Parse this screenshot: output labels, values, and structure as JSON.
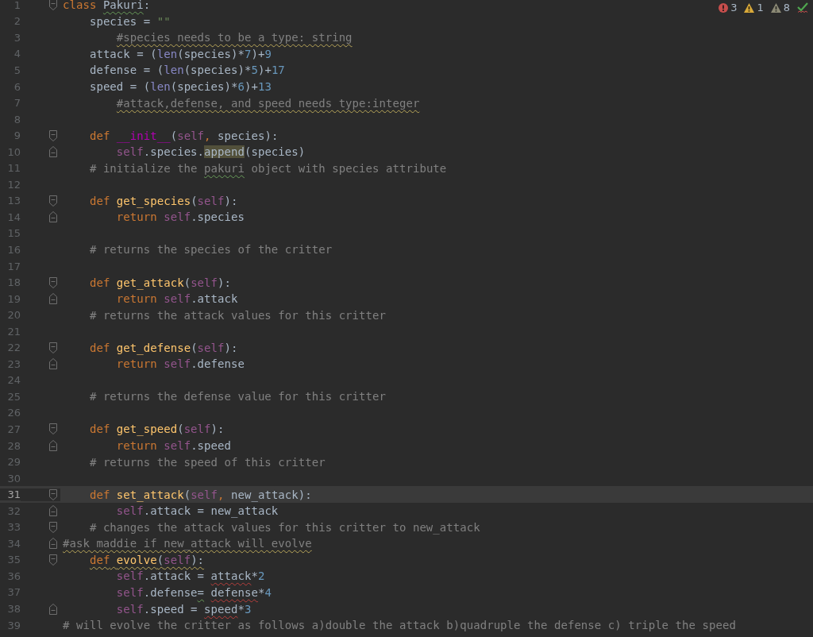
{
  "inspections": {
    "errors": "3",
    "warnings": "1",
    "weak_warnings": "8"
  },
  "lines": [
    {
      "number": "1",
      "current": false,
      "fold": {
        "kind": "start"
      },
      "tokens": [
        {
          "text": "class ",
          "kind": "keyword"
        },
        {
          "text": "Pakuri",
          "kind": "plain",
          "squiggle": {
            "kind": "typo"
          }
        },
        {
          "text": ":",
          "kind": "plain"
        }
      ]
    },
    {
      "number": "2",
      "current": false,
      "tokens": [
        {
          "text": "    species = ",
          "kind": "plain"
        },
        {
          "text": "\"\"",
          "kind": "string"
        }
      ]
    },
    {
      "number": "3",
      "current": false,
      "tokens": [
        {
          "text": "        #species needs to be a type: string",
          "kind": "comment",
          "squiggle": {
            "kind": "warning"
          }
        }
      ]
    },
    {
      "number": "4",
      "current": false,
      "tokens": [
        {
          "text": "    attack = (",
          "kind": "plain"
        },
        {
          "text": "len",
          "kind": "builtin"
        },
        {
          "text": "(species)*",
          "kind": "plain"
        },
        {
          "text": "7",
          "kind": "number"
        },
        {
          "text": ")+",
          "kind": "plain"
        },
        {
          "text": "9",
          "kind": "number"
        }
      ]
    },
    {
      "number": "5",
      "current": false,
      "tokens": [
        {
          "text": "    defense = (",
          "kind": "plain"
        },
        {
          "text": "len",
          "kind": "builtin"
        },
        {
          "text": "(species)*",
          "kind": "plain"
        },
        {
          "text": "5",
          "kind": "number"
        },
        {
          "text": ")+",
          "kind": "plain"
        },
        {
          "text": "17",
          "kind": "number"
        }
      ]
    },
    {
      "number": "6",
      "current": false,
      "tokens": [
        {
          "text": "    speed = (",
          "kind": "plain"
        },
        {
          "text": "len",
          "kind": "builtin"
        },
        {
          "text": "(species)*",
          "kind": "plain"
        },
        {
          "text": "6",
          "kind": "number"
        },
        {
          "text": ")+",
          "kind": "plain"
        },
        {
          "text": "13",
          "kind": "number"
        }
      ]
    },
    {
      "number": "7",
      "current": false,
      "tokens": [
        {
          "text": "        #attack,defense, and speed needs type:integer",
          "kind": "comment",
          "squiggle": {
            "kind": "warning"
          }
        }
      ]
    },
    {
      "number": "8",
      "current": false
    },
    {
      "number": "9",
      "current": false,
      "fold": {
        "kind": "start"
      },
      "tokens": [
        {
          "text": "    def ",
          "kind": "keyword"
        },
        {
          "text": "__init__",
          "kind": "magic"
        },
        {
          "text": "(",
          "kind": "plain"
        },
        {
          "text": "self",
          "kind": "self"
        },
        {
          "text": ", ",
          "kind": "keyword"
        },
        {
          "text": "species):",
          "kind": "plain"
        }
      ]
    },
    {
      "number": "10",
      "current": false,
      "fold": {
        "kind": "end"
      },
      "tokens": [
        {
          "text": "        self",
          "kind": "self"
        },
        {
          "text": ".species.",
          "kind": "plain"
        },
        {
          "text": "append",
          "kind": "plain",
          "highlight": true
        },
        {
          "text": "(species)",
          "kind": "plain"
        }
      ]
    },
    {
      "number": "11",
      "current": false,
      "tokens": [
        {
          "text": "    # initialize the ",
          "kind": "comment"
        },
        {
          "text": "pakuri",
          "kind": "comment",
          "squiggle": {
            "kind": "typo"
          }
        },
        {
          "text": " object with species attribute",
          "kind": "comment"
        }
      ]
    },
    {
      "number": "12",
      "current": false
    },
    {
      "number": "13",
      "current": false,
      "fold": {
        "kind": "start"
      },
      "tokens": [
        {
          "text": "    def ",
          "kind": "keyword"
        },
        {
          "text": "get_species",
          "kind": "function"
        },
        {
          "text": "(",
          "kind": "plain"
        },
        {
          "text": "self",
          "kind": "self"
        },
        {
          "text": "):",
          "kind": "plain"
        }
      ]
    },
    {
      "number": "14",
      "current": false,
      "fold": {
        "kind": "end"
      },
      "tokens": [
        {
          "text": "        return ",
          "kind": "keyword"
        },
        {
          "text": "self",
          "kind": "self"
        },
        {
          "text": ".species",
          "kind": "plain"
        }
      ]
    },
    {
      "number": "15",
      "current": false
    },
    {
      "number": "16",
      "current": false,
      "tokens": [
        {
          "text": "    # returns the species of the critter",
          "kind": "comment"
        }
      ]
    },
    {
      "number": "17",
      "current": false
    },
    {
      "number": "18",
      "current": false,
      "fold": {
        "kind": "start"
      },
      "tokens": [
        {
          "text": "    def ",
          "kind": "keyword"
        },
        {
          "text": "get_attack",
          "kind": "function"
        },
        {
          "text": "(",
          "kind": "plain"
        },
        {
          "text": "self",
          "kind": "self"
        },
        {
          "text": "):",
          "kind": "plain"
        }
      ]
    },
    {
      "number": "19",
      "current": false,
      "fold": {
        "kind": "end"
      },
      "tokens": [
        {
          "text": "        return ",
          "kind": "keyword"
        },
        {
          "text": "self",
          "kind": "self"
        },
        {
          "text": ".attack",
          "kind": "plain"
        }
      ]
    },
    {
      "number": "20",
      "current": false,
      "tokens": [
        {
          "text": "    # returns the attack values for this critter",
          "kind": "comment"
        }
      ]
    },
    {
      "number": "21",
      "current": false
    },
    {
      "number": "22",
      "current": false,
      "fold": {
        "kind": "start"
      },
      "tokens": [
        {
          "text": "    def ",
          "kind": "keyword"
        },
        {
          "text": "get_defense",
          "kind": "function"
        },
        {
          "text": "(",
          "kind": "plain"
        },
        {
          "text": "self",
          "kind": "self"
        },
        {
          "text": "):",
          "kind": "plain"
        }
      ]
    },
    {
      "number": "23",
      "current": false,
      "fold": {
        "kind": "end"
      },
      "tokens": [
        {
          "text": "        return ",
          "kind": "keyword"
        },
        {
          "text": "self",
          "kind": "self"
        },
        {
          "text": ".defense",
          "kind": "plain"
        }
      ]
    },
    {
      "number": "24",
      "current": false
    },
    {
      "number": "25",
      "current": false,
      "tokens": [
        {
          "text": "    # returns the defense value for this critter",
          "kind": "comment"
        }
      ]
    },
    {
      "number": "26",
      "current": false
    },
    {
      "number": "27",
      "current": false,
      "fold": {
        "kind": "start"
      },
      "tokens": [
        {
          "text": "    def ",
          "kind": "keyword"
        },
        {
          "text": "get_speed",
          "kind": "function"
        },
        {
          "text": "(",
          "kind": "plain"
        },
        {
          "text": "self",
          "kind": "self"
        },
        {
          "text": "):",
          "kind": "plain"
        }
      ]
    },
    {
      "number": "28",
      "current": false,
      "fold": {
        "kind": "end"
      },
      "tokens": [
        {
          "text": "        return ",
          "kind": "keyword"
        },
        {
          "text": "self",
          "kind": "self"
        },
        {
          "text": ".speed",
          "kind": "plain"
        }
      ]
    },
    {
      "number": "29",
      "current": false,
      "tokens": [
        {
          "text": "    # returns the speed of this critter",
          "kind": "comment"
        }
      ]
    },
    {
      "number": "30",
      "current": false
    },
    {
      "number": "31",
      "current": true,
      "fold": {
        "kind": "start"
      },
      "tokens": [
        {
          "text": "    def ",
          "kind": "keyword"
        },
        {
          "text": "set_attack",
          "kind": "function"
        },
        {
          "text": "(",
          "kind": "plain"
        },
        {
          "text": "self",
          "kind": "self"
        },
        {
          "text": ", ",
          "kind": "keyword"
        },
        {
          "text": "new_attack):",
          "kind": "plain"
        }
      ]
    },
    {
      "number": "32",
      "current": false,
      "fold": {
        "kind": "end"
      },
      "tokens": [
        {
          "text": "        self",
          "kind": "self"
        },
        {
          "text": ".attack = new_attack",
          "kind": "plain"
        }
      ]
    },
    {
      "number": "33",
      "current": false,
      "fold": {
        "kind": "start"
      },
      "tokens": [
        {
          "text": "    # changes the attack values for this critter to new_attack",
          "kind": "comment"
        }
      ]
    },
    {
      "number": "34",
      "current": false,
      "fold": {
        "kind": "end"
      },
      "tokens": [
        {
          "text": "#ask maddie if new_attack will evolve",
          "kind": "comment",
          "squiggle": {
            "kind": "warning"
          }
        }
      ]
    },
    {
      "number": "35",
      "current": false,
      "fold": {
        "kind": "start"
      },
      "tokens": [
        {
          "text": "    def ",
          "kind": "keyword",
          "squiggle": {
            "kind": "warning"
          }
        },
        {
          "text": "evolve",
          "kind": "function",
          "squiggle": {
            "kind": "warning"
          }
        },
        {
          "text": "(",
          "kind": "plain",
          "squiggle": {
            "kind": "warning"
          }
        },
        {
          "text": "self",
          "kind": "self",
          "squiggle": {
            "kind": "warning"
          }
        },
        {
          "text": "):",
          "kind": "plain",
          "squiggle": {
            "kind": "warning"
          }
        }
      ]
    },
    {
      "number": "36",
      "current": false,
      "tokens": [
        {
          "text": "        self",
          "kind": "self"
        },
        {
          "text": ".attack = ",
          "kind": "plain"
        },
        {
          "text": "attack",
          "kind": "plain",
          "squiggle": {
            "kind": "error"
          }
        },
        {
          "text": "*",
          "kind": "plain"
        },
        {
          "text": "2",
          "kind": "number"
        }
      ]
    },
    {
      "number": "37",
      "current": false,
      "tokens": [
        {
          "text": "        self",
          "kind": "self"
        },
        {
          "text": ".defense",
          "kind": "plain"
        },
        {
          "text": "= ",
          "kind": "plain",
          "squiggle": {
            "kind": "typo"
          }
        },
        {
          "text": "defense",
          "kind": "plain",
          "squiggle": {
            "kind": "error"
          }
        },
        {
          "text": "*",
          "kind": "plain"
        },
        {
          "text": "4",
          "kind": "number"
        }
      ]
    },
    {
      "number": "38",
      "current": false,
      "fold": {
        "kind": "end"
      },
      "tokens": [
        {
          "text": "        self",
          "kind": "self"
        },
        {
          "text": ".speed = ",
          "kind": "plain"
        },
        {
          "text": "speed",
          "kind": "plain",
          "squiggle": {
            "kind": "error"
          }
        },
        {
          "text": "*",
          "kind": "plain"
        },
        {
          "text": "3",
          "kind": "number"
        }
      ]
    },
    {
      "number": "39",
      "current": false,
      "tokens": [
        {
          "text": "# will evolve the critter as follows a)double the attack b)quadruple the defense c) triple the speed",
          "kind": "comment"
        }
      ]
    }
  ]
}
